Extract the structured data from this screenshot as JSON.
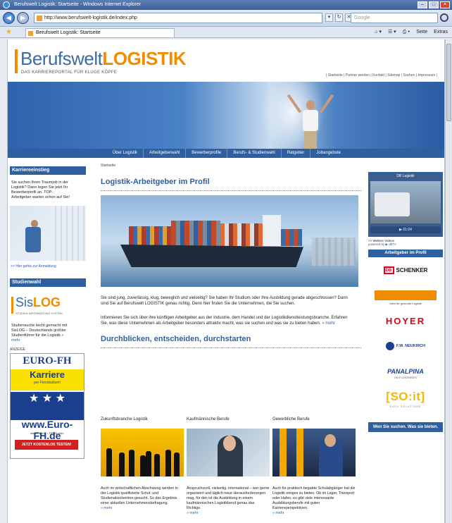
{
  "browser": {
    "window_title": "Berufswelt Logistik: Startseite - Windows Internet Explorer",
    "url": "http://www.berufswelt-logistik.de/index.php",
    "search_placeholder": "Google",
    "tab_title": "Berufswelt Logistik: Startseite",
    "cmd_extras": "Seite",
    "cmd_tools": "Extras"
  },
  "header": {
    "logo_part1": "Berufswelt",
    "logo_part2": "LOGISTIK",
    "tagline": "DAS KARRIEREPORTAL FÜR KLUGE KÖPFE",
    "toplinks": "| Startseite | Partner werden | Kontakt | Sitemap | Suchen | Impressum |"
  },
  "mainnav": [
    "Über Logistik",
    "Arbeitgeberwahl",
    "Bewerberprofile",
    "Berufs- & Studienwahl",
    "Ratgeber",
    "Jobangebote"
  ],
  "left": {
    "box1_title": "Karriereeinstieg",
    "box1_text": "Sie suchen Ihren Traumjob in der Logistik? Dann legen Sie jetzt Ihr Bewerberprofil an. TOP-Arbeitgeber warten schon auf Sie!",
    "box1_link": ">> Hier gehts zur Anmeldung",
    "box2_title": "Studienwahl",
    "sislog_a": "Sis",
    "sislog_b": "LOG",
    "sislog_sub": "STUDIEN INFORMATIONS SYSTEM",
    "box2_text": "Studiensuche leicht gemacht mit SisLOG – Deutschlands größter Studienführer für die Logistik",
    "box2_more": "» mehr",
    "ad_label": "ANZEIGE",
    "ad_brand": "EURO-FH",
    "ad_karriere": "Karriere",
    "ad_fern": "per Fernstudium!",
    "ad_stars": "★ ★ ★",
    "ad_url": "www.Euro-FH.de",
    "ad_tiny": "staatl. anerk. • FIBAA-akkr.",
    "ad_cta": "JETZT KOSTENLOS TESTEN!"
  },
  "center": {
    "breadcrumb": "Startseite",
    "h1": "Logistik-Arbeitgeber im Profil",
    "p1": "Sie sind jung, zuverlässig, klug, beweglich und vielseitig? Sie haben Ihr Studium oder Ihre Ausbildung gerade abgeschlossen? Dann sind Sie auf Berufswelt LOGISTIK genau richtig. Denn hier finden Sie die Unternehmen, die Sie suchen.",
    "p2": "Informieren Sie sich über ihre künftigen Arbeitgeber aus der Industrie, dem Handel und der Logistikdienstleistungsbranche. Erfahren Sie, was diese Unternehmen als Arbeitgeber besonders attraktiv macht, was sie suchen und was sie zu bieten haben.",
    "p2_more": "» mehr",
    "h2": "Durchblicken, entscheiden, durchstarten",
    "columns": [
      {
        "title": "Zukunftsbranche Logistik",
        "text": "Auch im wirtschaftlichen Abschwung werden in der Logistik qualifizierte Schul- und Studienabsolventen gesucht. So das Ergebnis einer aktuellen Unternehmensbefragung.",
        "more": "» mehr"
      },
      {
        "title": "Kaufmännische Berufe",
        "text": "Anspruchsvoll, vielseitig, international – wer gerne organisiert und täglich neue Herausforderungen mag, für den ist die Ausbildung in einem kaufmännischen Logistikberuf genau das Richtige.",
        "more": "» mehr"
      },
      {
        "title": "Gewerbliche Berufe",
        "text": "Auch für praktisch begabte Schulabgänger hat die Logistik einiges zu bieten. Ob im Lager, Transport oder Hafen, es gibt viele interessante Ausbildungsberufe mit guten Karriereperspektiven.",
        "more": "» mehr"
      }
    ]
  },
  "right": {
    "video_title": "DB Logistik",
    "video_ctrl": "01:24",
    "video_caption": ">> Weitere Videos",
    "video_powered": "powered by ▶ dbTV",
    "employers_title": "Arbeitgeber im Profil",
    "employers": [
      {
        "name": "SCHENKER",
        "badge": "DB"
      },
      {
        "name": "Alles für gesunde Logistik",
        "kind": "orange"
      },
      {
        "name": "HOYER"
      },
      {
        "name": "F.W. NEUKIRCH",
        "sub": "INTERNATIONALE SPEDITION"
      },
      {
        "name": "PANALPINA",
        "sub": "ON 5 CONTINENTS"
      },
      {
        "name": "[SO:it]",
        "sub": "EASY SOLUTIONS"
      }
    ],
    "cta": "Wen Sie suchen. Was sie bieten."
  },
  "colors": {
    "brand_blue": "#2f5f9f",
    "brand_orange": "#f08c00",
    "db_red": "#e2001a"
  }
}
